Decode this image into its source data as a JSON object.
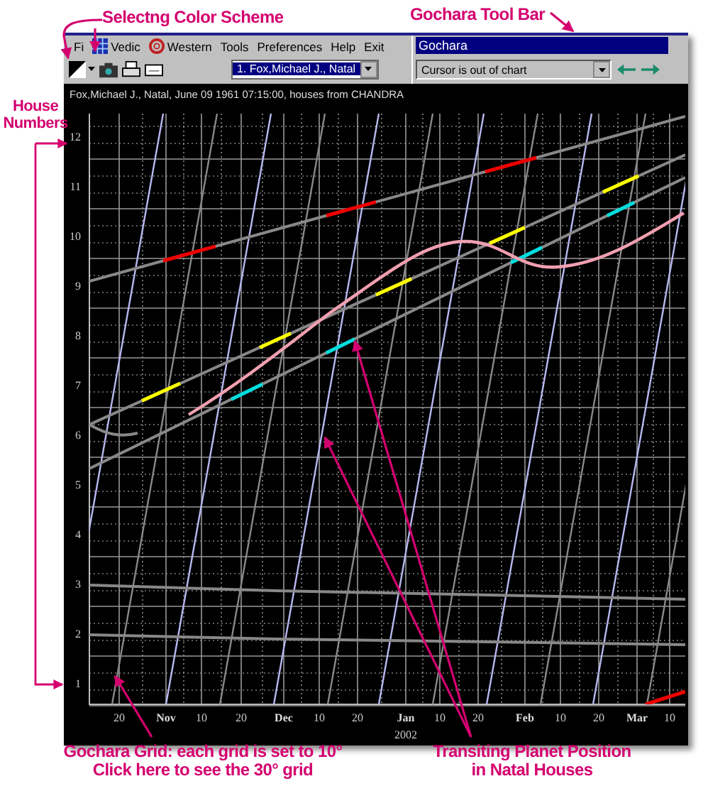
{
  "annotations": {
    "color_scheme": "Selectng Color Scheme",
    "toolbar": "Gochara Tool Bar",
    "house_numbers": [
      "House",
      "Numbers"
    ],
    "grid": [
      "Gochara Grid: each grid is set to 10°",
      "Click here to see the 30° grid"
    ],
    "transits": [
      "Transiting Planet Position",
      "in Natal Houses"
    ]
  },
  "menu": [
    {
      "kind": "text",
      "label": "Fi"
    },
    {
      "kind": "vedic",
      "label": "Vedic"
    },
    {
      "kind": "western",
      "label": "Western"
    },
    {
      "kind": "text",
      "label": "Tools"
    },
    {
      "kind": "text",
      "label": "Preferences"
    },
    {
      "kind": "text",
      "label": "Help"
    },
    {
      "kind": "text",
      "label": "Exit"
    }
  ],
  "chart_selector": {
    "value": "1. Fox,Michael J., Natal"
  },
  "gochara_toolbar": {
    "title": "Gochara",
    "status": "Cursor is out of chart"
  },
  "chart": {
    "header": "Fox,Michael J., Natal, June 09 1961 07:15:00, houses from CHANDRA",
    "y_ticks": [
      "12",
      "11",
      "10",
      "9",
      "8",
      "7",
      "6",
      "5",
      "4",
      "3",
      "2",
      "1"
    ],
    "x_ticks": [
      {
        "kind": "day",
        "label": "20"
      },
      {
        "kind": "month",
        "label": "Nov"
      },
      {
        "kind": "day",
        "label": "10"
      },
      {
        "kind": "day",
        "label": "20"
      },
      {
        "kind": "month",
        "label": "Dec"
      },
      {
        "kind": "day",
        "label": "10"
      },
      {
        "kind": "day",
        "label": "20"
      },
      {
        "kind": "month",
        "label": "Jan",
        "sub": "2002"
      },
      {
        "kind": "day",
        "label": "10"
      },
      {
        "kind": "day",
        "label": "20"
      },
      {
        "kind": "month",
        "label": "Feb"
      },
      {
        "kind": "day",
        "label": "10"
      },
      {
        "kind": "day",
        "label": "20"
      },
      {
        "kind": "month",
        "label": "Mar"
      },
      {
        "kind": "day",
        "label": "10"
      }
    ]
  }
}
